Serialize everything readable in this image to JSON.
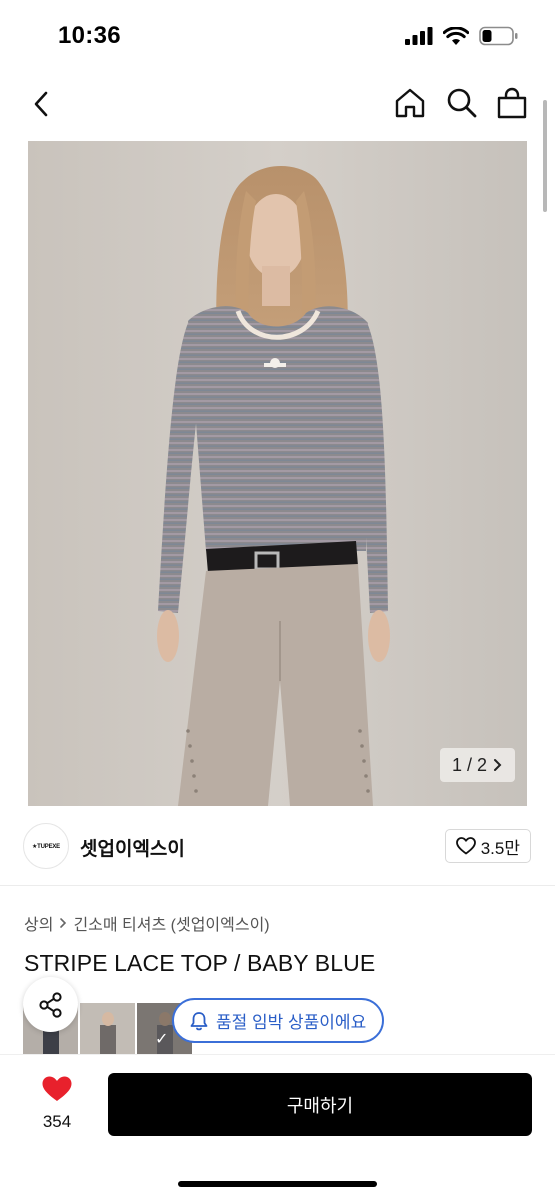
{
  "status": {
    "time": "10:36",
    "battery_level": 0.25
  },
  "nav": {
    "icons": [
      "chevron-left-icon",
      "home-icon",
      "search-icon",
      "shopping-bag-icon"
    ]
  },
  "gallery": {
    "indicator": "1 / 2",
    "current": 1,
    "total": 2
  },
  "brand": {
    "logo_text": "★TUPEXE",
    "name": "셋업이엑스이",
    "like_count": "3.5만"
  },
  "breadcrumb": {
    "category": "상의",
    "subcategory": "긴소매 티셔츠 (셋업이엑스이)"
  },
  "product": {
    "title": "STRIPE LACE TOP / BABY BLUE"
  },
  "stock_notice": {
    "label": "품절 임박 상품이에요",
    "color": "#3b6fd8"
  },
  "bottom": {
    "like_count": "354",
    "buy_label": "구매하기",
    "heart_color": "#e8212c"
  }
}
